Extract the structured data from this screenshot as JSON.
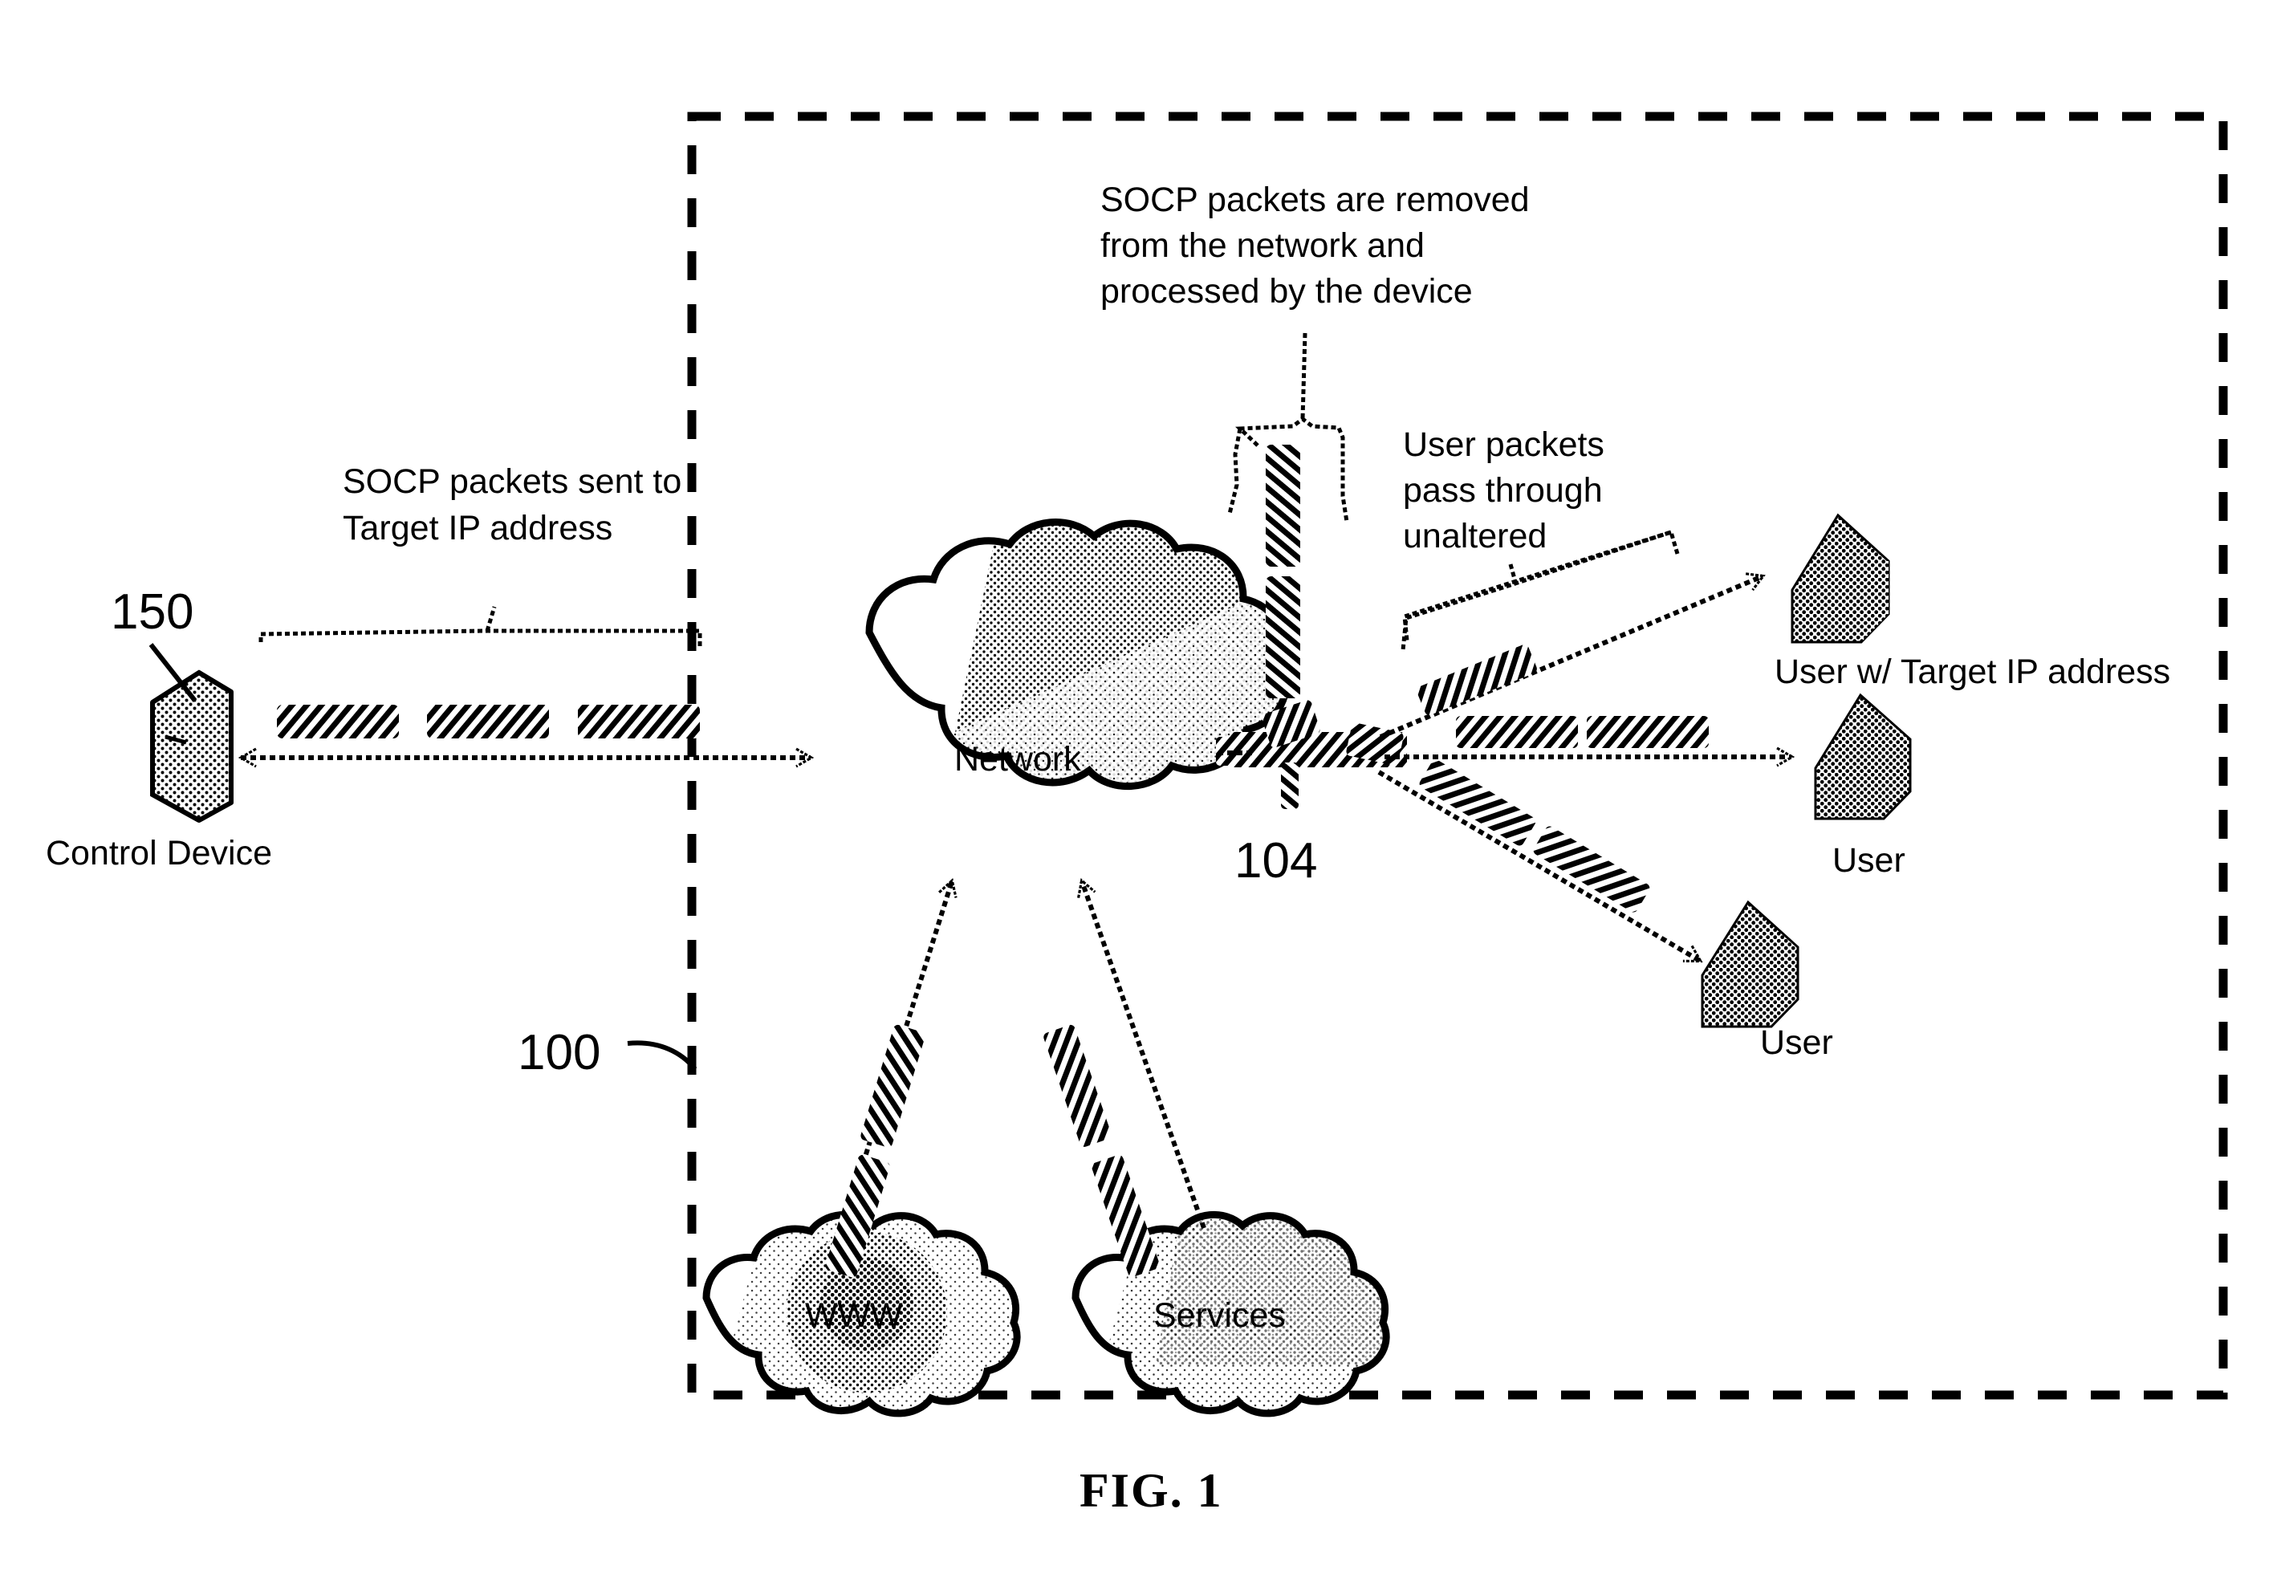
{
  "figure": {
    "caption": "FIG. 1",
    "reference_numerals": {
      "system": "100",
      "control_device": "150",
      "network_device": "104"
    }
  },
  "annotations": {
    "socp_sent": {
      "line1": "SOCP packets sent to",
      "line2": "Target IP address"
    },
    "socp_removed": {
      "line1": "SOCP packets are removed",
      "line2": "from the network and",
      "line3": "processed by the device"
    },
    "user_packets": {
      "line1": "User packets",
      "line2": "pass through",
      "line3": "unaltered"
    }
  },
  "nodes": {
    "control_device": {
      "label": "Control Device",
      "icon": "computer-box-icon"
    },
    "network_cloud": {
      "label": "Network",
      "icon": "cloud-icon"
    },
    "www_cloud": {
      "label": "WWW",
      "icon": "cloud-globe-icon"
    },
    "services_cloud": {
      "label": "Services",
      "icon": "cloud-icon"
    },
    "user_target": {
      "label": "User w/ Target IP address",
      "icon": "house-icon"
    },
    "user_middle": {
      "label": "User",
      "icon": "house-icon"
    },
    "user_bottom": {
      "label": "User",
      "icon": "house-icon"
    }
  },
  "colors": {
    "ink": "#000000",
    "paper": "#ffffff"
  }
}
